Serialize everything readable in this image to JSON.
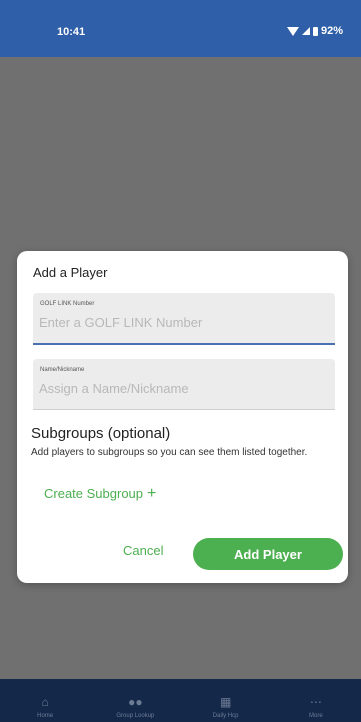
{
  "status_bar": {
    "time": "10:41",
    "battery": "92%"
  },
  "dialog": {
    "title": "Add a Player",
    "golf_link": {
      "label": "GOLF LINK Number",
      "placeholder": "Enter a GOLF LINK Number"
    },
    "nickname": {
      "label": "Name/Nickname",
      "placeholder": "Assign a Name/Nickname"
    },
    "subgroups": {
      "title": "Subgroups (optional)",
      "description": "Add players to subgroups so you can see them listed together.",
      "create_label": "Create Subgroup",
      "create_icon": "+"
    },
    "cancel_label": "Cancel",
    "add_label": "Add Player"
  },
  "bottom_nav": {
    "items": [
      {
        "label": "Home",
        "icon": "home-icon"
      },
      {
        "label": "Group Lookup",
        "icon": "group-icon"
      },
      {
        "label": "Daily Hcp",
        "icon": "calendar-icon"
      },
      {
        "label": "More",
        "icon": "more-icon"
      }
    ]
  }
}
